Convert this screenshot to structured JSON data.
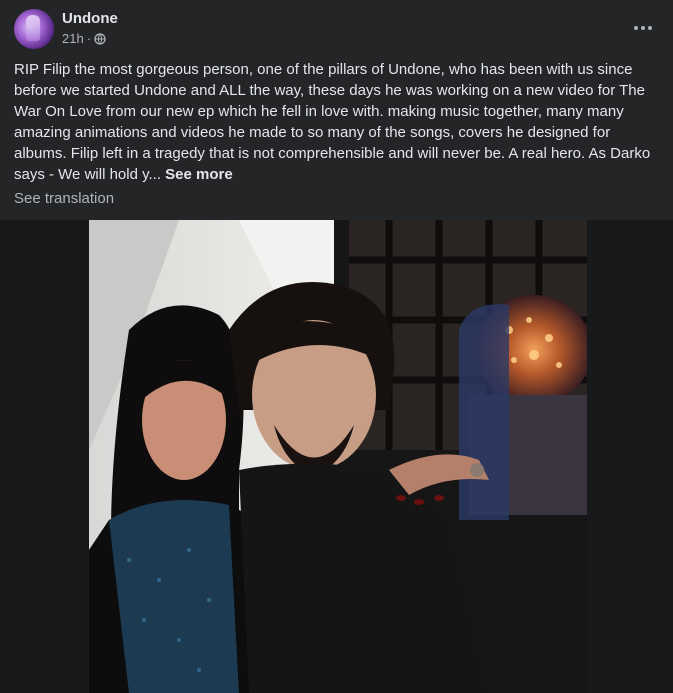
{
  "post": {
    "page_name": "Undone",
    "time": "21h",
    "body_text": "RIP Filip the most gorgeous person, one of the pillars of Undone, who has been with us since before we started Undone and ALL the way, these days he was working on a new video for The War On Love from our new ep which he fell in love with. making music together, many many amazing animations and videos he made to so many of the songs, covers he designed for albums. Filip left in a tragedy that is not comprehensible and will never be. A real hero. As Darko says - We will hold y...",
    "see_more_label": "See more",
    "see_translation_label": "See translation",
    "audience_icon": "globe-icon",
    "more_icon": "more-horizontal-icon"
  },
  "colors": {
    "background": "#242526",
    "text_primary": "#e4e6eb",
    "text_secondary": "#b0b3b8",
    "media_background": "#18191a"
  }
}
